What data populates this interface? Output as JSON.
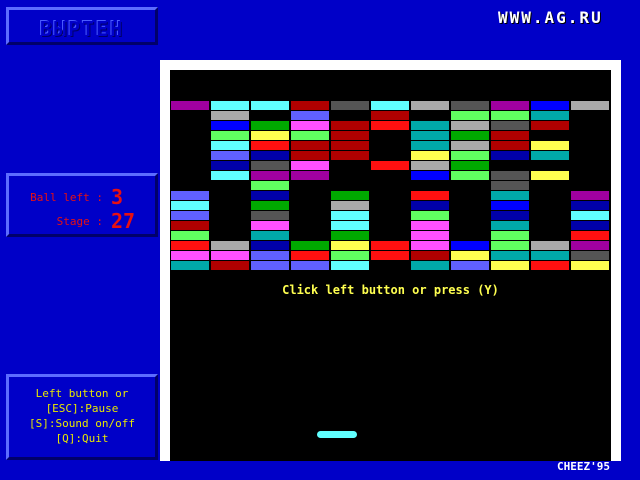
{
  "title_panel": {
    "title": "ВЫРТЕН"
  },
  "site_logo": "WWW.AG.RU",
  "stats": {
    "balls_label": "Ball left :",
    "balls_value": "3",
    "stage_label": "Stage :",
    "stage_value": "27"
  },
  "help": {
    "lines": [
      "Left button or",
      "[ESC]:Pause",
      "[S]:Sound on/off",
      "[Q]:Quit"
    ]
  },
  "prompt": "Click left button or press (Y)",
  "credit": "CHEEZ'95",
  "colors": {
    "background": "#0000c8",
    "text_red": "#e81010",
    "text_yellow": "#e8e800",
    "paddle": "#60ffff"
  },
  "palette": {
    "P": "#a000a0",
    "C": "#60ffff",
    "R": "#b00000",
    "D": "#555555",
    "S": "#aaaaaa",
    "B": "#0000a8",
    "G": "#00a800",
    "L": "#60ff60",
    "T": "#00a8a8",
    "V": "#6060ff",
    "r": "#ff1010",
    "Y": "#ffff50",
    "M": "#ff50ff",
    "N": "#0000ff"
  },
  "bricks": [
    "PCCRDCSDPNS",
    ".S.V.R.LLT.",
    ".NGMRrTSDR.",
    ".LYLR.TGR..",
    ".CrRR.TSRY.",
    ".VBRR.YLBT.",
    ".BDM.rSG...",
    ".CPP..NLDY.",
    "..L.....D..",
    "V.B.G.r.T.P",
    "C.G.S.B.N.B",
    "V.D.C.L.B.C",
    "R.M.C.M.T.B",
    "L.T.G.M.L.r",
    "rSBGYrMNLSP",
    "MMVrLrRYTTD",
    "TRVVC.TVYrY"
  ]
}
